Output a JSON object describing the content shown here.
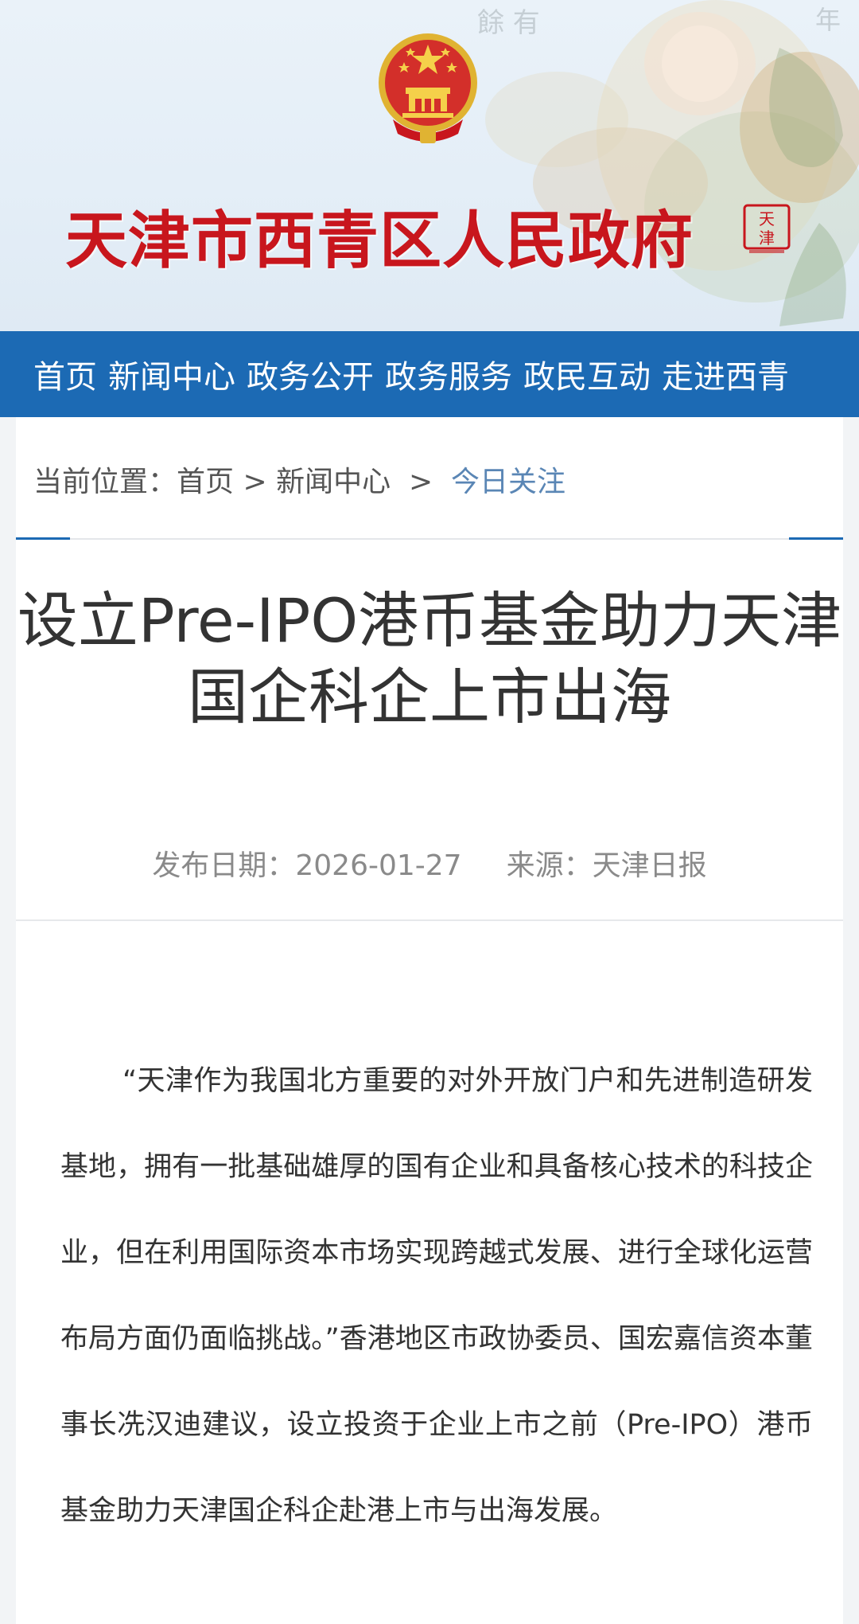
{
  "header": {
    "site_title": "天津市西青区人民政府",
    "seal_text": "天津"
  },
  "nav": {
    "items": [
      {
        "label": "首页"
      },
      {
        "label": "新闻中心"
      },
      {
        "label": "政务公开"
      },
      {
        "label": "政务服务"
      },
      {
        "label": "政民互动"
      },
      {
        "label": "走进西青"
      }
    ]
  },
  "breadcrumb": {
    "prefix": "当前位置：",
    "home": "首页",
    "sep1": " > ",
    "section": "新闻中心",
    "sep2": "  >  ",
    "current": "今日关注"
  },
  "article": {
    "title": "设立Pre-IPO港币基金助力天津国企科企上市出海",
    "date_label": "发布日期：",
    "date": "2026-01-27",
    "source_label": "来源：",
    "source": "天津日报",
    "body": "“天津作为我国北方重要的对外开放门户和先进制造研发基地，拥有一批基础雄厚的国有企业和具备核心技术的科技企业，但在利用国际资本市场实现跨越式发展、进行全球化运营布局方面仍面临挑战。”香港地区市政协委员、国宏嘉信资本董事长冼汉迪建议，设立投资于企业上市之前（Pre-IPO）港币基金助力天津国企科企赴港上市与出海发展。"
  },
  "colors": {
    "nav_bg": "#1c6ab4",
    "title_red": "#c8161d",
    "breadcrumb_current": "#5a86b5"
  }
}
